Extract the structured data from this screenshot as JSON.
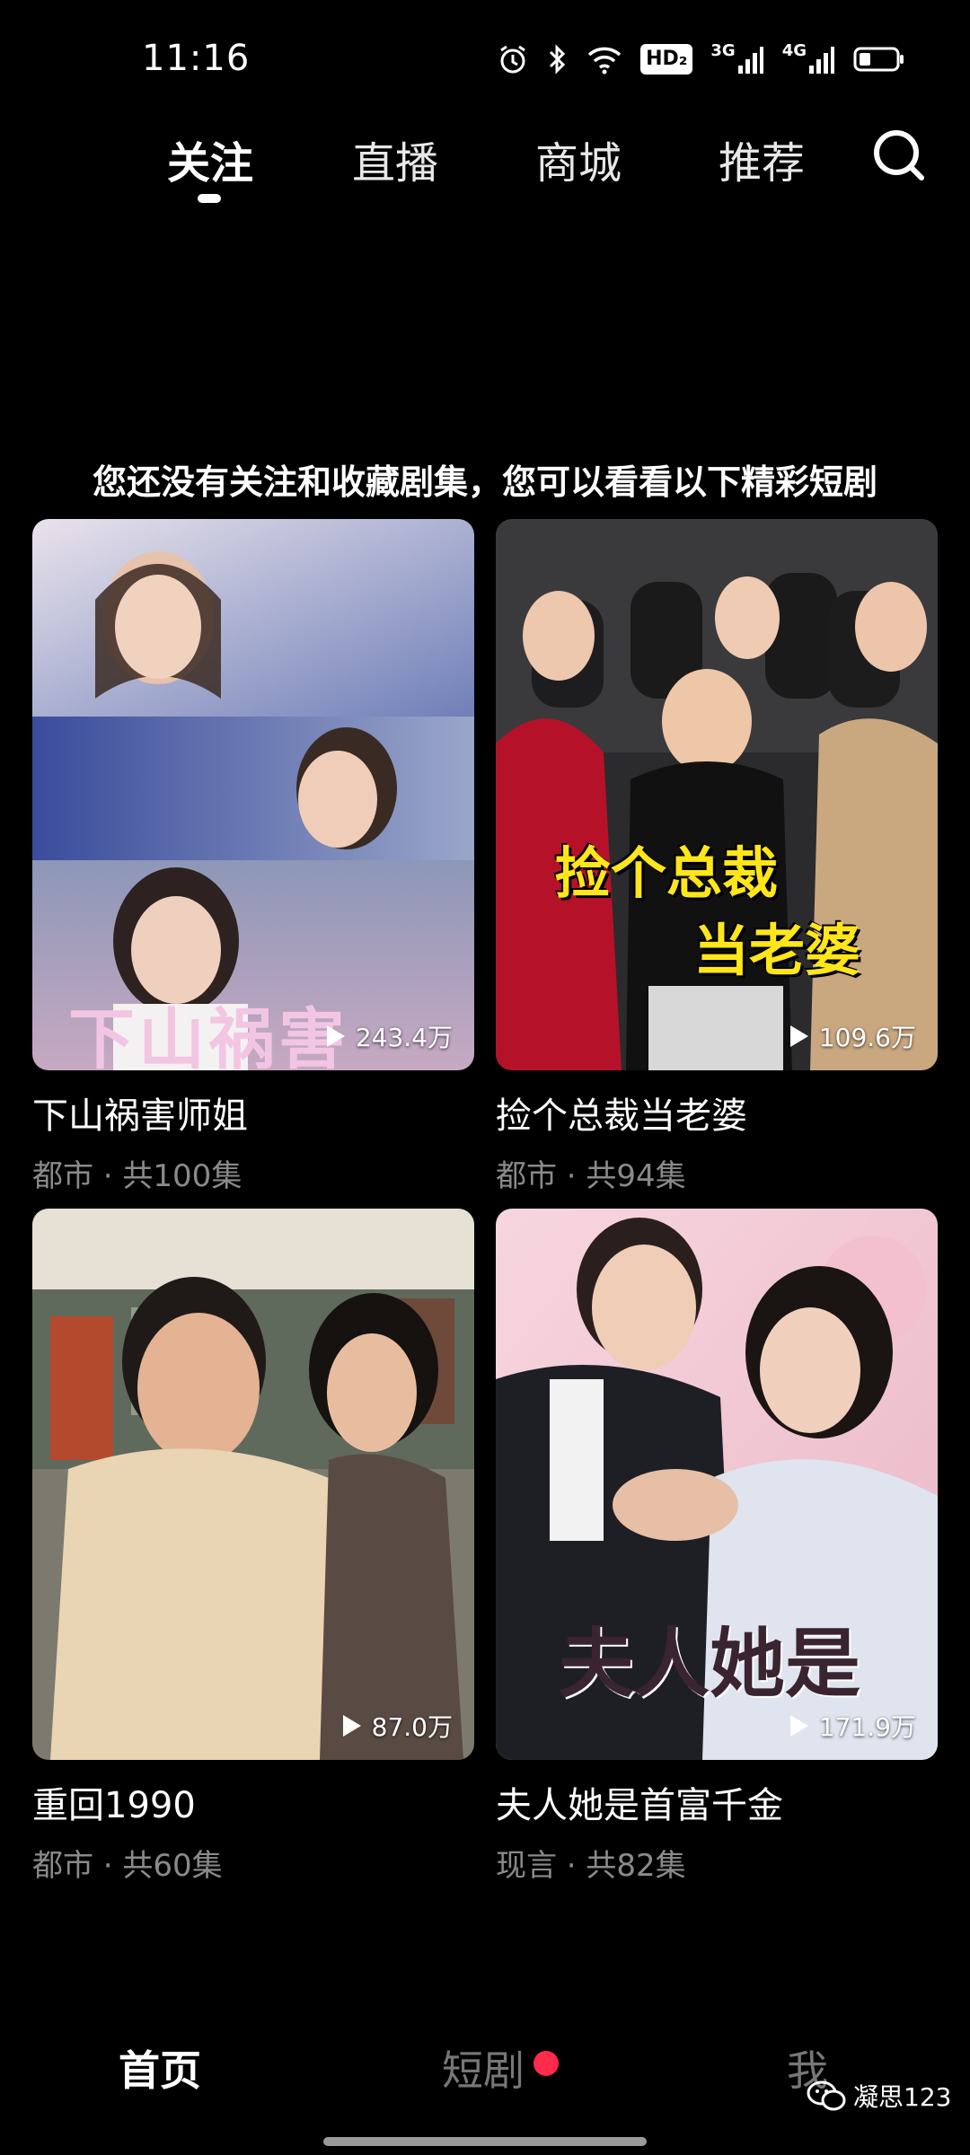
{
  "status_bar": {
    "time": "11:16",
    "hd_badge": "HD₂",
    "net1": "3G",
    "net2": "4G"
  },
  "top_nav": {
    "tabs": [
      {
        "label": "关注",
        "active": true
      },
      {
        "label": "直播",
        "active": false
      },
      {
        "label": "商城",
        "active": false
      },
      {
        "label": "推荐",
        "active": false
      }
    ],
    "search_icon": "search-icon"
  },
  "hint": "您还没有关注和收藏剧集，您可以看看以下精彩短剧",
  "cards": [
    {
      "title": "下山祸害师姐",
      "meta": "都市 · 共100集",
      "plays": "243.4万",
      "poster_text": "下山祸害",
      "poster_color": "#f2c6e3"
    },
    {
      "title": "捡个总裁当老婆",
      "meta": "都市 · 共94集",
      "plays": "109.6万",
      "poster_text": "捡个总裁",
      "poster_text2": "当老婆",
      "poster_color": "#ffe61a"
    },
    {
      "title": "重回1990",
      "meta": "都市 · 共60集",
      "plays": "87.0万"
    },
    {
      "title": "夫人她是首富千金",
      "meta": "现言 · 共82集",
      "plays": "171.9万",
      "poster_text": "夫人她是",
      "poster_color": "#3a2430"
    }
  ],
  "bottom_nav": {
    "items": [
      {
        "label": "首页",
        "active": true
      },
      {
        "label": "短剧",
        "active": false,
        "badge": true
      },
      {
        "label": "我",
        "active": false
      }
    ]
  },
  "watermark": "凝思123",
  "colors": {
    "background": "#000000",
    "accent_dot": "#ff2b4a",
    "meta_text": "#8a8a8a"
  }
}
